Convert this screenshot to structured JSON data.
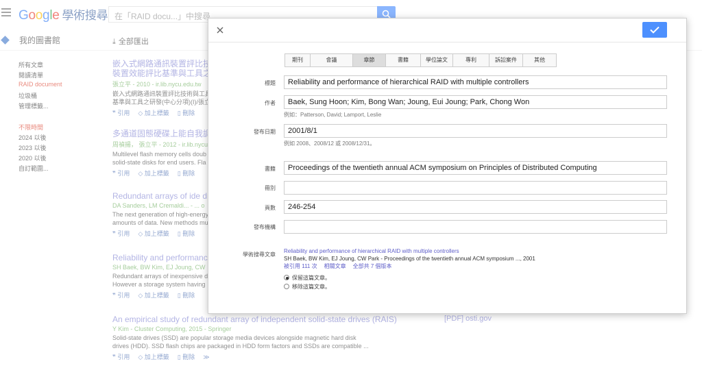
{
  "header": {
    "logo_g1": "G",
    "logo_o1": "o",
    "logo_o2": "o",
    "logo_g2": "g",
    "logo_l": "l",
    "logo_e": "e",
    "logo_suffix": "學術搜尋",
    "search_placeholder": "在「RAID docu...」中搜尋"
  },
  "library": {
    "title": "我的圖書館",
    "export_all": "全部匯出"
  },
  "sidebar": {
    "items": [
      {
        "label": "所有文章"
      },
      {
        "label": "閱讀清單"
      },
      {
        "label": "RAID document"
      },
      {
        "label": "垃圾桶"
      },
      {
        "label": "管理標籤..."
      }
    ],
    "time": [
      {
        "label": "不限時間"
      },
      {
        "label": "2024 以後"
      },
      {
        "label": "2023 以後"
      },
      {
        "label": "2020 以後"
      },
      {
        "label": "自訂範圍..."
      }
    ]
  },
  "results": [
    {
      "title": "嵌入式網路通訊裝置評比技",
      "title2": "裝置效能評比基準與工具之",
      "authors": "張立平 - 2010 - ir.lib.nycu.edu.tw",
      "snippet": "嵌入式網路通訊裝置評比技術與工具",
      "snippet2": "基準與工具之研發(中心分項)(I)/張立",
      "cite": "引用",
      "tag": "加上標籤",
      "del": "刪除"
    },
    {
      "title": "多通道固態硬碟上能自我調",
      "authors": "周禎揚， 張立平 - 2012 - ir.lib.nycu",
      "snippet": "Multilevel flash memory cells doub",
      "snippet2": "solid-state disks for end users. Fla",
      "cite": "引用",
      "tag": "加上標籤",
      "del": "刪除"
    },
    {
      "title": "Redundant arrays of ide dr",
      "authors": "DA Sanders, LM Cremaldi... - ... o",
      "snippet": "The next generation of high-energy",
      "snippet2": "amounts of data. New methods mu",
      "cite": "引用",
      "tag": "加上標籤",
      "del": "刪除"
    },
    {
      "title": "Reliability and performance",
      "authors": "SH Baek, BW Kim, EJ Joung, CW",
      "snippet": "Redundant arrays of inexpensive d",
      "snippet2": "However a storage system having",
      "cite": "引用",
      "tag": "加上標籤",
      "del": "刪除"
    },
    {
      "title": "An empirical study of redundant array of independent solid-state drives (RAIS)",
      "authors": "Y Kim - Cluster Computing, 2015 - Springer",
      "snippet": "Solid-state drives (SSD) are popular storage media devices alongside magnetic hard disk",
      "snippet2": "drives (HDD). SSD flash chips are packaged in HDD form factors and SSDs are compatible ...",
      "cite": "引用",
      "tag": "加上標籤",
      "del": "刪除",
      "pdf_tag": "[PDF]",
      "pdf_src": "osti.gov"
    }
  ],
  "dialog": {
    "tabs": [
      "期刊",
      "會議",
      "章節",
      "書籍",
      "學位論文",
      "專利",
      "訴訟案件",
      "其他"
    ],
    "selected_tab": "章節",
    "fields": {
      "title_label": "標題",
      "title_value": "Reliability and performance of hierarchical RAID with multiple controllers",
      "author_label": "作者",
      "author_value": "Baek, Sung Hoon; Kim, Bong Wan; Joung, Eui Joung; Park, Chong Won",
      "author_hint": "例如：Patterson, David; Lamport, Leslie",
      "date_label": "發布日期",
      "date_value": "2001/8/1",
      "date_hint": "例如 2008、2008/12 或 2008/12/31。",
      "book_label": "書籍",
      "book_value": "Proceedings of the twentieth annual ACM symposium on Principles of Distributed Computing",
      "volume_label": "冊別",
      "volume_value": "",
      "pages_label": "頁數",
      "pages_value": "246-254",
      "publisher_label": "發布機構",
      "publisher_value": ""
    },
    "scholar": {
      "label": "學術搜尋文章",
      "title": "Reliability and performance of hierarchical RAID with multiple controllers",
      "authors": "SH Baek, BW Kim, EJ Joung, CW Park - Proceedings of the twentieth annual ACM symposium ..., 2001",
      "cited": "被引用 111 次",
      "related": "相關文章",
      "versions": "全部共 7 個版本",
      "keep": "保留這篇文章。",
      "remove": "移除這篇文章。"
    }
  }
}
